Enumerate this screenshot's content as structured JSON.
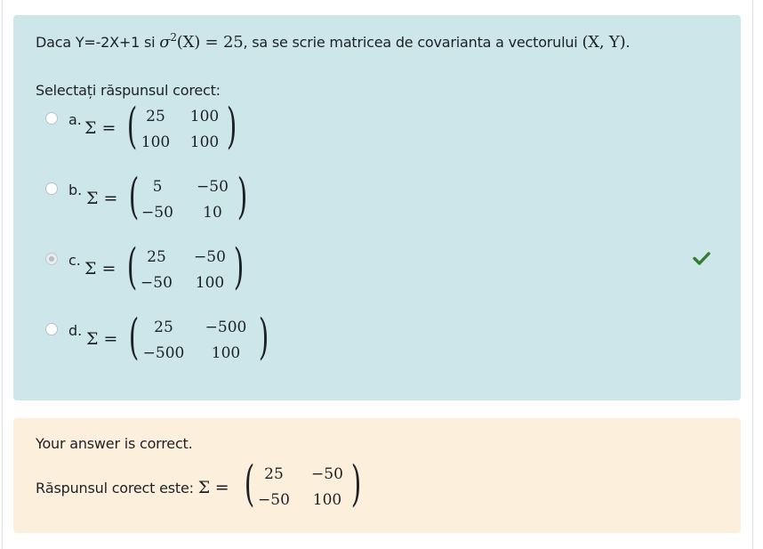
{
  "question": {
    "text_prefix": "Daca Y=-2X+1 si ",
    "formula_sigma": "σ",
    "formula_sup": "2",
    "formula_rest": "(X) = 25",
    "text_mid": ", sa se scrie matricea de covarianta a vectorului ",
    "vector": "(X, Y)",
    "text_end": "."
  },
  "prompt": "Selectați răspunsul corect:",
  "sigma_label": "Σ =",
  "options": [
    {
      "letter": "a.",
      "matrix": [
        "25",
        "100",
        "100",
        "100"
      ],
      "selected": false
    },
    {
      "letter": "b.",
      "matrix": [
        "5",
        "−50",
        "−50",
        "10"
      ],
      "selected": false
    },
    {
      "letter": "c.",
      "matrix": [
        "25",
        "−50",
        "−50",
        "100"
      ],
      "selected": true
    },
    {
      "letter": "d.",
      "matrix": [
        "25",
        "−500",
        "−500",
        "100"
      ],
      "selected": false
    }
  ],
  "status_icon": "check-icon",
  "colors": {
    "question_bg": "#cce6ea",
    "feedback_bg": "#fcefdc",
    "check": "#357a32"
  },
  "feedback": {
    "message": "Your answer is correct.",
    "right_answer_label": "Răspunsul corect este: ",
    "right_answer_matrix": [
      "25",
      "−50",
      "−50",
      "100"
    ]
  }
}
